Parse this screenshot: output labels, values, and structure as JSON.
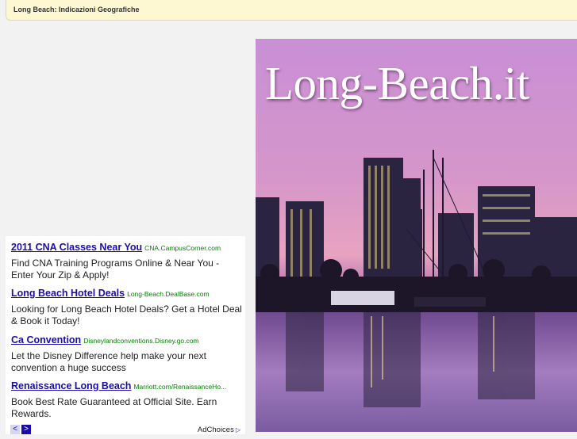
{
  "header": {
    "breadcrumb": "Long Beach: Indicazioni Geografiche"
  },
  "hero": {
    "site_title": "Long-Beach.it"
  },
  "ads": [
    {
      "title": "2011 CNA Classes Near You",
      "url": "CNA.CampusCorner.com",
      "description": "Find CNA Training Programs Online & Near You - Enter Your Zip & Apply!"
    },
    {
      "title": "Long Beach Hotel Deals",
      "url": "Long-Beach.DealBase.com",
      "description": "Looking for Long Beach Hotel Deals? Get a Hotel Deal & Book it Today!"
    },
    {
      "title": "Ca Convention",
      "url": "Disneylandconventions.Disney.go.com",
      "description": "Let the Disney Difference help make your next convention a huge success"
    },
    {
      "title": "Renaissance Long Beach",
      "url": "Marriott.com/RenaissanceHo...",
      "description": "Book Best Rate Guaranteed at Official Site. Earn Rewards."
    }
  ],
  "ad_footer": {
    "prev_icon": "<",
    "next_icon": ">",
    "adchoices_label": "AdChoices",
    "adchoices_icon": "▷"
  },
  "colors": {
    "ad_title": "#1a0dab",
    "ad_url": "#008000",
    "header_bg": "#fdf8d2"
  }
}
